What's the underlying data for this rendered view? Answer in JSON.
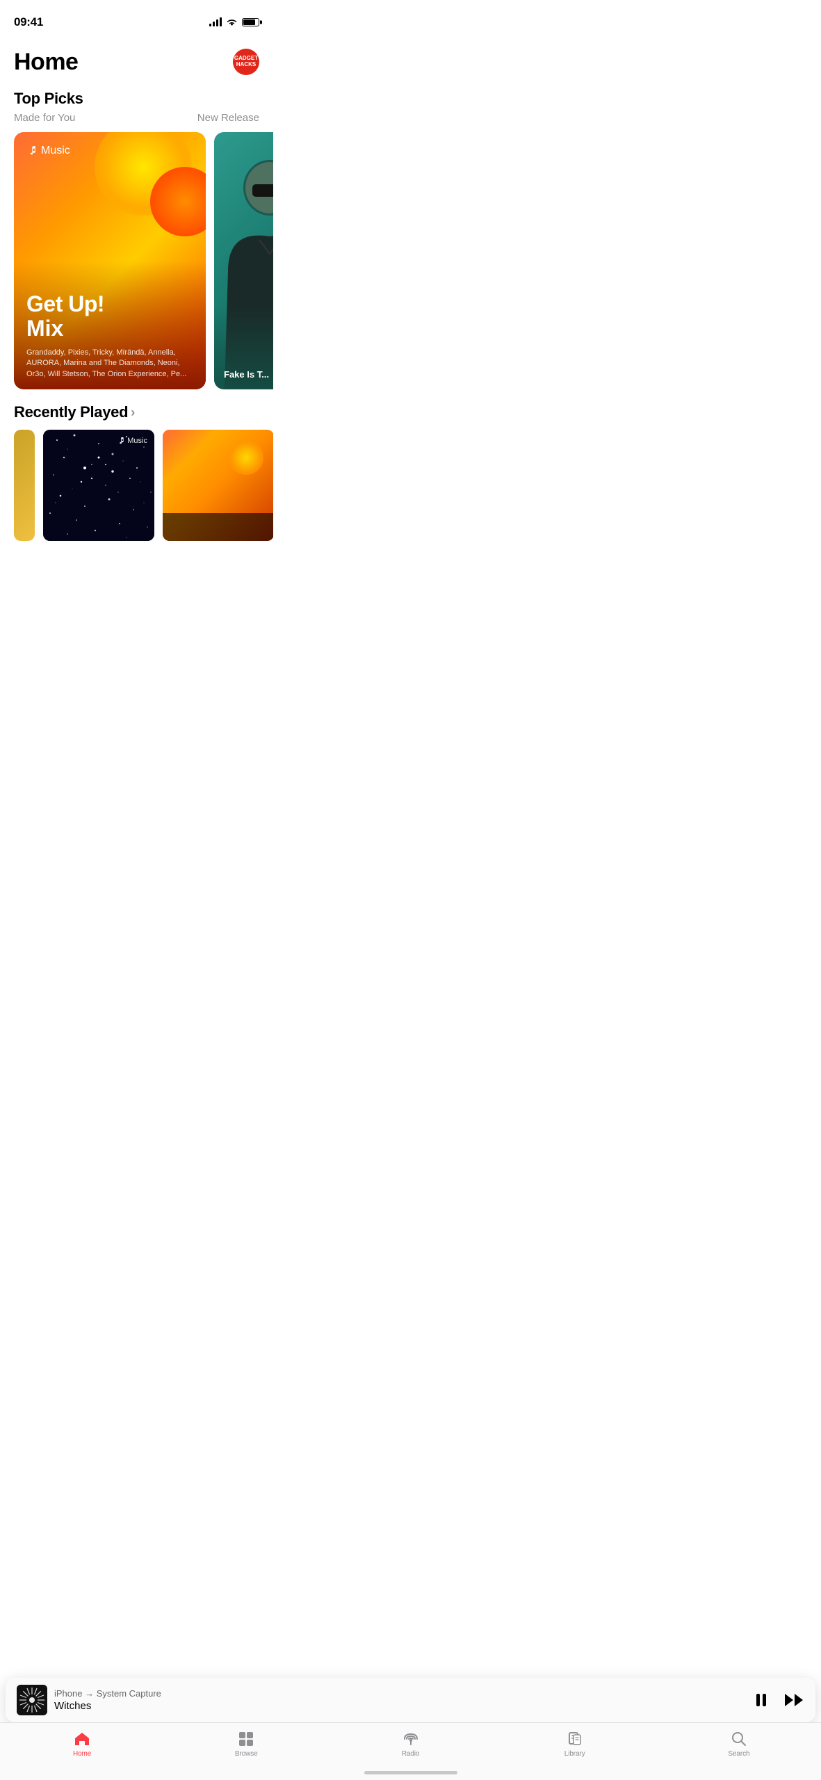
{
  "statusBar": {
    "time": "09:41",
    "signalBars": 4,
    "wifi": true,
    "battery": 80
  },
  "header": {
    "title": "Home",
    "avatar": {
      "line1": "GADGET",
      "line2": "HACKS"
    }
  },
  "topPicks": {
    "sectionTitle": "Top Picks",
    "subtitle": "Made for You",
    "linkText": "New Release",
    "mainCard": {
      "appleMusicLabel": "Music",
      "titleLine1": "Get Up!",
      "titleLine2": "Mix",
      "artists": "Grandaddy, Pixies, Tricky, Mïrändä, Annella, AURORA, Marina and The Diamonds, Neoni, Or3o, Will Stetson, The Orion Experience, Pe..."
    },
    "secondCard": {
      "text": "Fake Is T..."
    }
  },
  "recentlyPlayed": {
    "sectionTitle": "Recently Played",
    "chevron": "›",
    "appleMusicBadge": "Music"
  },
  "nowPlaying": {
    "route": "iPhone → System Capture",
    "track": "Witches",
    "pauseLabel": "pause",
    "forwardLabel": "fast-forward"
  },
  "tabBar": {
    "tabs": [
      {
        "id": "home",
        "label": "Home",
        "active": true
      },
      {
        "id": "browse",
        "label": "Browse",
        "active": false
      },
      {
        "id": "radio",
        "label": "Radio",
        "active": false
      },
      {
        "id": "library",
        "label": "Library",
        "active": false
      },
      {
        "id": "search",
        "label": "Search",
        "active": false
      }
    ]
  }
}
